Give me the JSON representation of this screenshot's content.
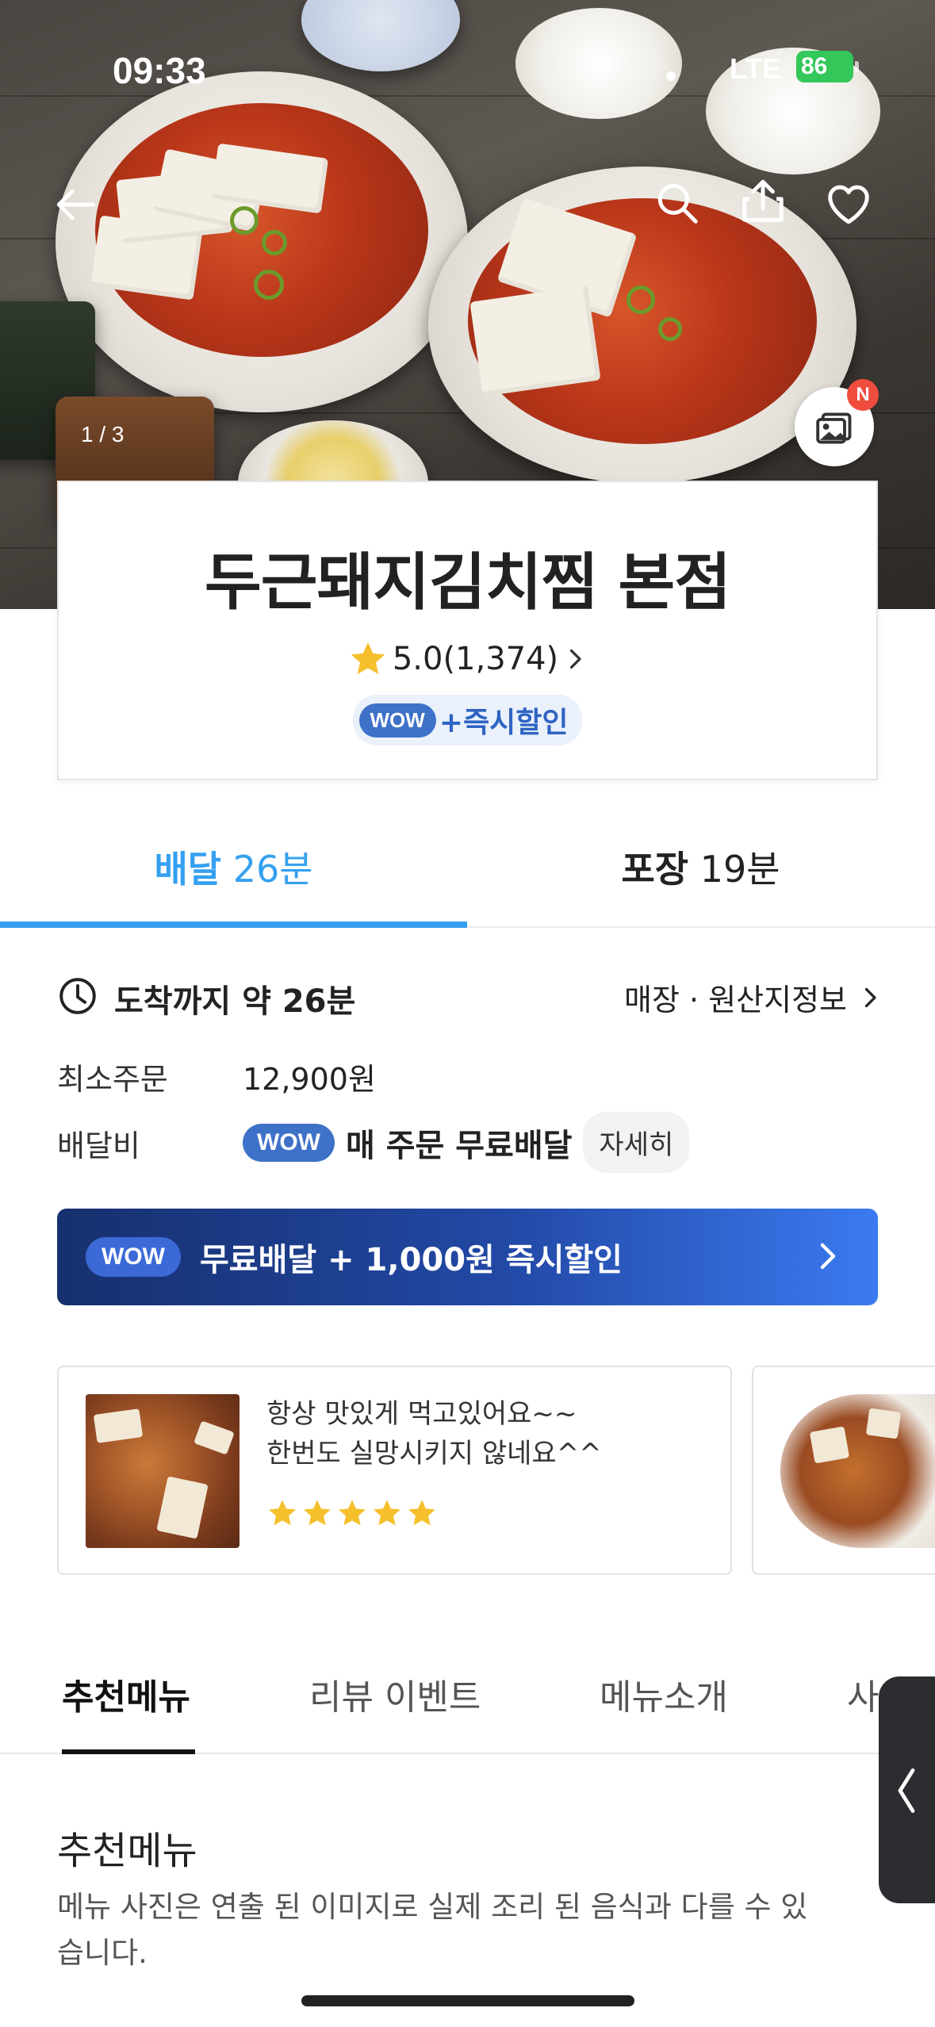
{
  "status_bar": {
    "time": "09:33",
    "network": "LTE",
    "battery": "86"
  },
  "hero": {
    "page_indicator": "1 / 3",
    "gallery_badge": "N"
  },
  "icons": {
    "back": "back-arrow-icon",
    "search": "search-icon",
    "share": "share-icon",
    "favorite": "heart-icon",
    "gallery": "gallery-icon",
    "star": "star-icon",
    "clock": "clock-icon"
  },
  "store": {
    "name": "두근돼지김치찜 본점",
    "rating": "5.0(1,374)",
    "wow_badge": "WOW",
    "promo": "+즉시할인"
  },
  "mode_tabs": [
    {
      "label": "배달",
      "time": "26분",
      "active": true
    },
    {
      "label": "포장",
      "time": "19분",
      "active": false
    }
  ],
  "info": {
    "eta": "도착까지 약 26분",
    "origin_link": "매장 · 원산지정보",
    "min_order_label": "최소주문",
    "min_order_value": "12,900원",
    "delivery_fee_label": "배달비",
    "delivery_fee_wow": "WOW",
    "delivery_fee_text": "매 주문 무료배달",
    "detail_button": "자세히"
  },
  "wow_banner": {
    "badge": "WOW",
    "text": "무료배달 + 1,000원 즉시할인"
  },
  "reviews": [
    {
      "line1": "항상 맛있게 먹고있어요~~",
      "line2": "한번도 실망시키지 않네요^^",
      "stars": 5
    }
  ],
  "menu_tabs": [
    "추천메뉴",
    "리뷰 이벤트",
    "메뉴소개",
    "사이"
  ],
  "section": {
    "title": "추천메뉴",
    "desc": "메뉴 사진은 연출 된 이미지로 실제 조리 된 음식과 다를 수 있습니다."
  },
  "colors": {
    "accent": "#35a0f0",
    "wow": "#3e71c8",
    "star": "#f6c02c",
    "banner_dark": "#17306e",
    "banner_light": "#3b7af0"
  }
}
